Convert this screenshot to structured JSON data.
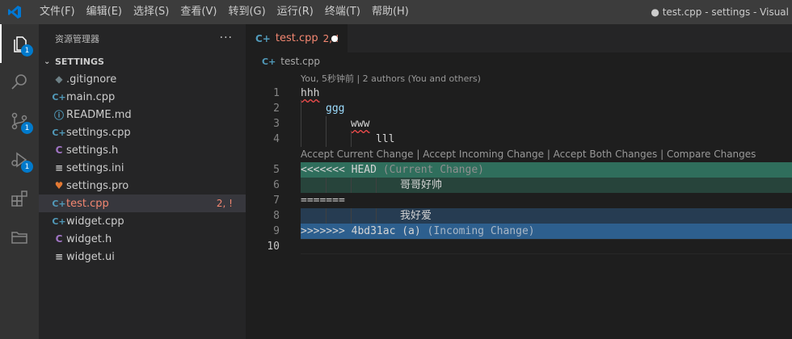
{
  "titlebar": {
    "menu": [
      "文件(F)",
      "编辑(E)",
      "选择(S)",
      "查看(V)",
      "转到(G)",
      "运行(R)",
      "终端(T)",
      "帮助(H)"
    ],
    "window_title": "● test.cpp - settings - Visual"
  },
  "activity_bar": {
    "explorer_badge": "1",
    "scm_badge": "1",
    "debug_badge": "1"
  },
  "sidebar": {
    "title": "资源管理器",
    "more": "···",
    "section": "SETTINGS",
    "files": [
      {
        "name": ".gitignore",
        "icon": "◆",
        "icon_color": "#6d8086"
      },
      {
        "name": "main.cpp",
        "icon": "C+",
        "icon_color": "#519aba"
      },
      {
        "name": "README.md",
        "icon": "ⓘ",
        "icon_color": "#519aba"
      },
      {
        "name": "settings.cpp",
        "icon": "C+",
        "icon_color": "#519aba"
      },
      {
        "name": "settings.h",
        "icon": "C",
        "icon_color": "#a074c4"
      },
      {
        "name": "settings.ini",
        "icon": "≡",
        "icon_color": "#cccccc"
      },
      {
        "name": "settings.pro",
        "icon": "♥",
        "icon_color": "#e37933"
      },
      {
        "name": "test.cpp",
        "icon": "C+",
        "icon_color": "#519aba",
        "badge": "2, !"
      },
      {
        "name": "widget.cpp",
        "icon": "C+",
        "icon_color": "#519aba"
      },
      {
        "name": "widget.h",
        "icon": "C",
        "icon_color": "#a074c4"
      },
      {
        "name": "widget.ui",
        "icon": "≡",
        "icon_color": "#cccccc"
      }
    ]
  },
  "editor": {
    "tab": {
      "name": "test.cpp",
      "badge": "2, !"
    },
    "breadcrumb": "test.cpp",
    "blame_lens": "You, 5秒钟前 | 2 authors (You and others)",
    "merge_lens": "Accept Current Change | Accept Incoming Change | Accept Both Changes | Compare Changes",
    "lines": [
      {
        "n": "1",
        "text": "hhh"
      },
      {
        "n": "2",
        "text": "ggg"
      },
      {
        "n": "3",
        "text": "www"
      },
      {
        "n": "4",
        "text": "lll"
      },
      {
        "n": "5",
        "text": "<<<<<<< HEAD",
        "hint": "(Current Change)"
      },
      {
        "n": "6",
        "text": "哥哥好帅"
      },
      {
        "n": "7",
        "text": "======="
      },
      {
        "n": "8",
        "text": "我好爱"
      },
      {
        "n": "9",
        "text": ">>>>>>> 4bd31ac (a)",
        "hint": "(Incoming Change)"
      },
      {
        "n": "10",
        "text": ""
      }
    ]
  },
  "colors": {
    "accent": "#007acc",
    "current_change_header": "#2f6e5c",
    "incoming_change_header": "#2d5f8e",
    "modified_file": "#f48771"
  }
}
